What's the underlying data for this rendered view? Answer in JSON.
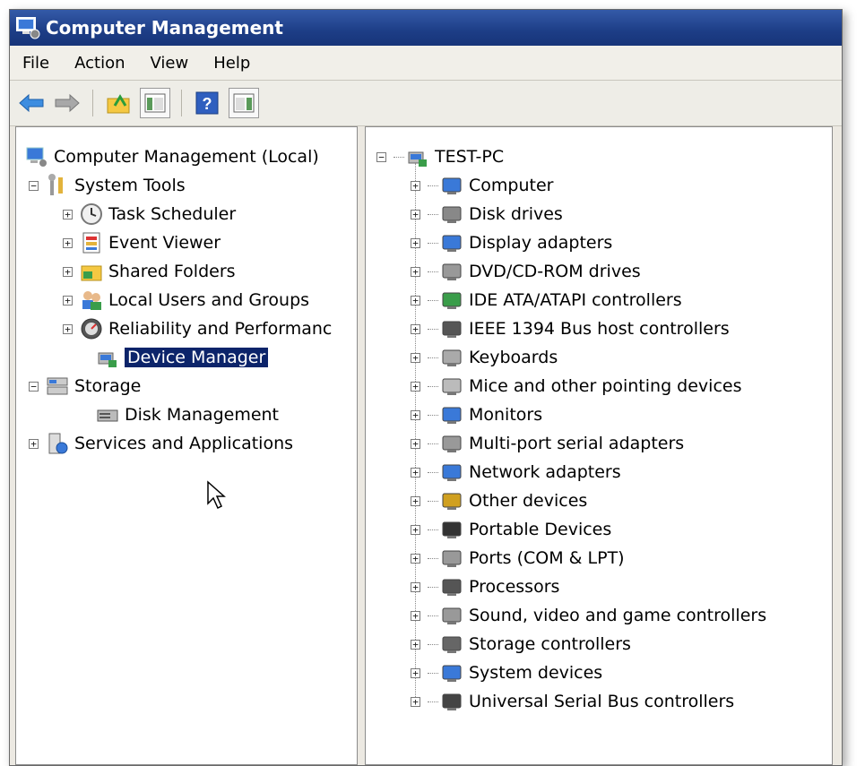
{
  "window": {
    "title": "Computer Management"
  },
  "menu": {
    "file": "File",
    "action": "Action",
    "view": "View",
    "help": "Help"
  },
  "toolbar": {
    "icons": [
      "back-arrow-icon",
      "forward-arrow-icon",
      "up-folder-icon",
      "show-hide-tree-icon",
      "help-icon",
      "action-pane-icon"
    ]
  },
  "tree": {
    "root": "Computer Management (Local)",
    "system_tools": "System Tools",
    "task_scheduler": "Task Scheduler",
    "event_viewer": "Event Viewer",
    "shared_folders": "Shared Folders",
    "local_users": "Local Users and Groups",
    "reliability": "Reliability and Performanc",
    "device_manager": "Device Manager",
    "storage": "Storage",
    "disk_management": "Disk Management",
    "services": "Services and Applications"
  },
  "devices": {
    "root": "TEST-PC",
    "items": [
      "Computer",
      "Disk drives",
      "Display adapters",
      "DVD/CD-ROM drives",
      "IDE ATA/ATAPI controllers",
      "IEEE 1394 Bus host controllers",
      "Keyboards",
      "Mice and other pointing devices",
      "Monitors",
      "Multi-port serial adapters",
      "Network adapters",
      "Other devices",
      "Portable Devices",
      "Ports (COM & LPT)",
      "Processors",
      "Sound, video and game controllers",
      "Storage controllers",
      "System devices",
      "Universal Serial Bus controllers"
    ]
  },
  "colors": {
    "titlebar": "#1d3d86",
    "selection": "#0c246a"
  }
}
